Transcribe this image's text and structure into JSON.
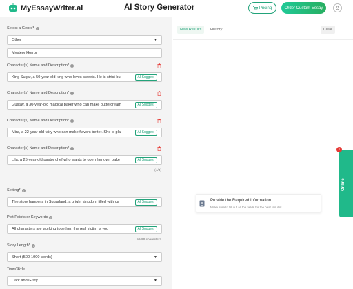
{
  "header": {
    "logo_text": "MyEssayWriter.ai",
    "title": "AI Story Generator",
    "pricing_label": "Pricing",
    "order_label": "Order Custom Essay"
  },
  "form": {
    "genre_label": "Select a Genre*",
    "genre_value": "Other",
    "genre_other_value": "Mystery Horror",
    "characters_label": "Character(s) Name and Description*",
    "ai_suggest_label": "AI Suggest",
    "characters": [
      {
        "value": "King Sugar, a 50-year-old king who loves sweets. He is strict bu"
      },
      {
        "value": "Gustav, a 30-year-old magical baker who can make buttercream"
      },
      {
        "value": "Mira, a 22-year-old fairy who can make flavors better. She is pla"
      },
      {
        "value": "Lila, a 25-year-old pastry chef who wants to open her own bake"
      }
    ],
    "characters_counter": "(4/4)",
    "setting_label": "Setting*",
    "setting_value": "The story happens in Sugarland, a bright kingdom filled with ca",
    "plot_label": "Plot Points or Keywords",
    "plot_value": "All characters are working together: the real victim is you",
    "plot_counter": "59/60 characters",
    "length_label": "Story Length*",
    "length_value": "Short (500-1000 words)",
    "tone_label": "Tone/Style",
    "tone_value": "Dark and Gritty"
  },
  "results": {
    "tab_new": "New Results",
    "tab_history": "History",
    "clear_label": "Clear",
    "empty_title": "Provide the Required Information",
    "empty_subtitle": "Make sure to fill out all the fields for the best results!"
  },
  "online": {
    "label": "Online",
    "badge": "1"
  },
  "colors": {
    "accent": "#22a37a",
    "online": "#20b98a",
    "delete": "#e53935"
  }
}
